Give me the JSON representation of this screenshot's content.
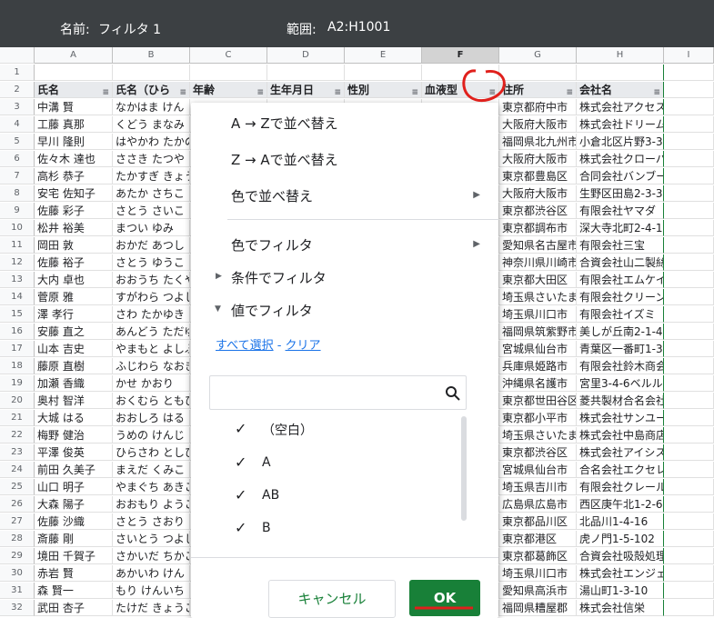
{
  "topbar": {
    "name_label": "名前:",
    "name_value": "フィルタ 1",
    "range_label": "範囲:",
    "range_value": "A2:H1001"
  },
  "columns": [
    "A",
    "B",
    "C",
    "D",
    "E",
    "F",
    "G",
    "H",
    "I"
  ],
  "rows": [
    {
      "num": "1",
      "cells": [
        "",
        "",
        "",
        "",
        "",
        "",
        "",
        ""
      ]
    },
    {
      "num": "2",
      "cells": [
        "氏名",
        "氏名（ひら",
        "年齢",
        "生年月日",
        "性別",
        "血液型",
        "住所",
        "会社名"
      ]
    },
    {
      "num": "3",
      "cells": [
        "中溝 賢",
        "なかはま けん",
        "",
        "",
        "",
        "",
        "東京都府中市",
        "株式会社アクセス"
      ]
    },
    {
      "num": "4",
      "cells": [
        "工藤 真那",
        "くどう まなみ",
        "",
        "",
        "",
        "",
        "大阪府大阪市",
        "株式会社ドリームファクトリ"
      ]
    },
    {
      "num": "5",
      "cells": [
        "早川 隆則",
        "はやかわ たかの",
        "",
        "",
        "",
        "",
        "福岡県北九州市",
        "小倉北区片野3-3"
      ]
    },
    {
      "num": "6",
      "cells": [
        "佐々木 達也",
        "ささき たつや",
        "",
        "",
        "",
        "",
        "大阪府大阪市",
        "株式会社クローバー"
      ]
    },
    {
      "num": "7",
      "cells": [
        "高杉 恭子",
        "たかすぎ きょう",
        "",
        "",
        "",
        "",
        "東京都豊島区",
        "合同会社バンブー・プロジ"
      ]
    },
    {
      "num": "8",
      "cells": [
        "安宅 佐知子",
        "あたか さちこ",
        "",
        "",
        "",
        "",
        "大阪府大阪市",
        "生野区田島2-3-3"
      ]
    },
    {
      "num": "9",
      "cells": [
        "佐藤 彩子",
        "さとう さいこ",
        "",
        "",
        "",
        "",
        "東京都渋谷区",
        "有限会社ヤマダ"
      ]
    },
    {
      "num": "10",
      "cells": [
        "松井 裕美",
        "まつい ゆみ",
        "",
        "",
        "",
        "",
        "東京都調布市",
        "深大寺北町2-4-19"
      ]
    },
    {
      "num": "11",
      "cells": [
        "岡田 敦",
        "おかだ あつし",
        "",
        "",
        "",
        "",
        "愛知県名古屋市",
        "有限会社三宝"
      ]
    },
    {
      "num": "12",
      "cells": [
        "佐藤 裕子",
        "さとう ゆうこ",
        "",
        "",
        "",
        "",
        "神奈川県川崎市",
        "合資会社山二製絲所"
      ]
    },
    {
      "num": "13",
      "cells": [
        "大内 卓也",
        "おおうち たくや",
        "",
        "",
        "",
        "",
        "東京都大田区",
        "有限会社エムケイ企画"
      ]
    },
    {
      "num": "14",
      "cells": [
        "菅原 雅",
        "すがわら つよし",
        "",
        "",
        "",
        "",
        "埼玉県さいたま市",
        "有限会社クリーンライフ"
      ]
    },
    {
      "num": "15",
      "cells": [
        "澤 孝行",
        "さわ たかゆき",
        "",
        "",
        "",
        "",
        "埼玉県川口市",
        "有限会社イズミ"
      ]
    },
    {
      "num": "16",
      "cells": [
        "安藤 直之",
        "あんどう ただゆ",
        "",
        "",
        "",
        "",
        "福岡県筑紫野市",
        "美しが丘南2-1-4"
      ]
    },
    {
      "num": "17",
      "cells": [
        "山本 吉史",
        "やまもと よしふ",
        "",
        "",
        "",
        "",
        "宮城県仙台市",
        "青葉区一番町1-3-1"
      ]
    },
    {
      "num": "18",
      "cells": [
        "藤原 直樹",
        "ふじわら なおき",
        "",
        "",
        "",
        "",
        "兵庫県姫路市",
        "有限会社鈴木商会"
      ]
    },
    {
      "num": "19",
      "cells": [
        "加瀬 香織",
        "かせ かおり",
        "",
        "",
        "",
        "",
        "沖縄県名護市",
        "宮里3-4-6ベルル51"
      ]
    },
    {
      "num": "20",
      "cells": [
        "奥村 智洋",
        "おくむら ともひ",
        "",
        "",
        "",
        "",
        "東京都世田谷区",
        "菱共製材合名会社"
      ]
    },
    {
      "num": "21",
      "cells": [
        "大城 はる",
        "おおしろ はる",
        "",
        "",
        "",
        "",
        "東京都小平市",
        "株式会社サンユー"
      ]
    },
    {
      "num": "22",
      "cells": [
        "梅野 健治",
        "うめの けんじ",
        "",
        "",
        "",
        "",
        "埼玉県さいたま市",
        "株式会社中島商店"
      ]
    },
    {
      "num": "23",
      "cells": [
        "平澤 俊英",
        "ひらさわ としひ",
        "",
        "",
        "",
        "",
        "東京都渋谷区",
        "株式会社アイシス"
      ]
    },
    {
      "num": "24",
      "cells": [
        "前田 久美子",
        "まえだ くみこ",
        "",
        "",
        "",
        "",
        "宮城県仙台市",
        "合名会社エクセレントサー"
      ]
    },
    {
      "num": "25",
      "cells": [
        "山口 明子",
        "やまぐち あきこ",
        "",
        "",
        "",
        "",
        "埼玉県吉川市",
        "有限会社クレール"
      ]
    },
    {
      "num": "26",
      "cells": [
        "大森 陽子",
        "おおもり ようこ",
        "",
        "",
        "",
        "",
        "広島県広島市",
        "西区庚午北1-2-6"
      ]
    },
    {
      "num": "27",
      "cells": [
        "佐藤 沙織",
        "さとう さおり",
        "",
        "",
        "",
        "",
        "東京都品川区",
        "北品川1-4-16"
      ]
    },
    {
      "num": "28",
      "cells": [
        "斎藤 剛",
        "さいとう つよし",
        "",
        "",
        "",
        "",
        "東京都港区",
        "虎ノ門1-5-102"
      ]
    },
    {
      "num": "29",
      "cells": [
        "境田 千賀子",
        "さかいだ ちかこ",
        "",
        "",
        "",
        "",
        "東京都葛飾区",
        "合資会社吸殻処理愛煙家協"
      ]
    },
    {
      "num": "30",
      "cells": [
        "赤岩 賢",
        "あかいわ けん",
        "",
        "",
        "",
        "",
        "埼玉県川口市",
        "株式会社エンジェル"
      ]
    },
    {
      "num": "31",
      "cells": [
        "森 賢一",
        "もり けんいち",
        "",
        "",
        "",
        "",
        "愛知県高浜市",
        "湯山町1-3-10"
      ]
    },
    {
      "num": "32",
      "cells": [
        "武田 杏子",
        "たけだ きょうこ",
        "",
        "",
        "",
        "",
        "福岡県糟屋郡",
        "株式会社信栄"
      ]
    }
  ],
  "popup": {
    "sort_az": "A → Zで並べ替え",
    "sort_za": "Z → Aで並べ替え",
    "sort_color": "色で並べ替え",
    "filter_color": "色でフィルタ",
    "filter_condition": "条件でフィルタ",
    "filter_values": "値でフィルタ",
    "select_all": "すべて選択",
    "link_sep": " - ",
    "clear": "クリア",
    "options": [
      "（空白）",
      "A",
      "AB",
      "B"
    ],
    "cancel": "キャンセル",
    "ok": "OK"
  },
  "colors": {
    "topbar": "#3c4043",
    "ok_bg": "#188038",
    "annotation": "#e0201c",
    "link": "#1a73e8"
  }
}
